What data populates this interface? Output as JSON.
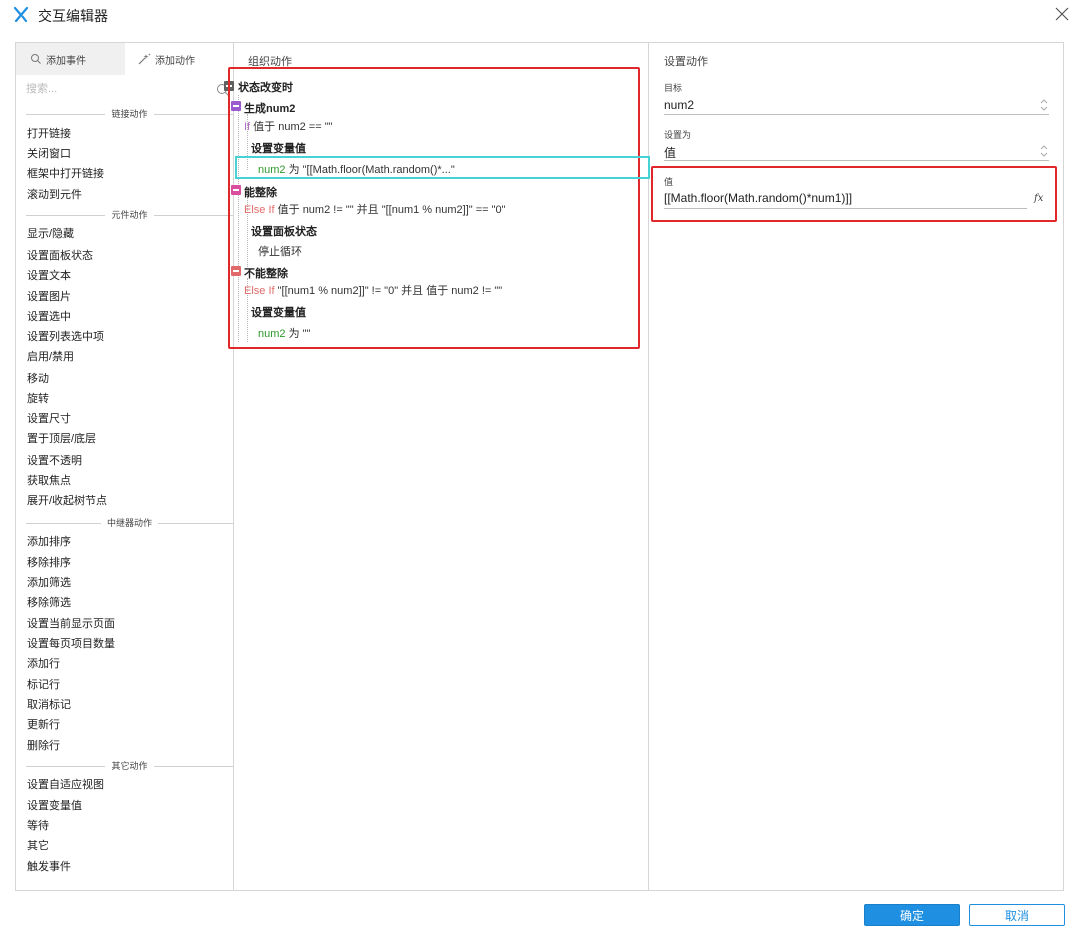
{
  "window": {
    "title": "交互编辑器",
    "accent": "#1e8fe1"
  },
  "left": {
    "tabs": [
      "添加事件",
      "添加动作"
    ],
    "search_placeholder": "搜索...",
    "groups": [
      {
        "header": "链接动作",
        "items": [
          "打开链接",
          "关闭窗口",
          "框架中打开链接",
          "滚动到元件"
        ]
      },
      {
        "header": "元件动作",
        "items": [
          "显示/隐藏",
          "设置面板状态",
          "设置文本",
          "设置图片",
          "设置选中",
          "设置列表选中项",
          "启用/禁用",
          "移动",
          "旋转",
          "设置尺寸",
          "置于顶层/底层",
          "设置不透明",
          "获取焦点",
          "展开/收起树节点"
        ]
      },
      {
        "header": "中继器动作",
        "items": [
          "添加排序",
          "移除排序",
          "添加筛选",
          "移除筛选",
          "设置当前显示页面",
          "设置每页项目数量",
          "添加行",
          "标记行",
          "取消标记",
          "更新行",
          "删除行"
        ]
      },
      {
        "header": "其它动作",
        "items": [
          "设置自适应视图",
          "设置变量值",
          "等待",
          "其它",
          "触发事件"
        ]
      }
    ]
  },
  "middle": {
    "title": "组织动作",
    "event": "状态改变时",
    "case1": {
      "name": "生成num2",
      "cond_kw": "If",
      "cond": " 值于 num2 == \"\"",
      "action": "设置变量值",
      "detail_var": "num2",
      "detail_rest": " 为 \"[[Math.floor(Math.random()*...\"",
      "color": "#9b59d0"
    },
    "case2": {
      "name": "能整除",
      "cond_kw": "Else If",
      "cond": " 值于 num2 != \"\" 并且 \"[[num1 % num2]]\" == \"0\"",
      "action": "设置面板状态",
      "detail": "停止循环",
      "color": "#d94f9e"
    },
    "case3": {
      "name": "不能整除",
      "cond_kw": "Else If",
      "cond": " \"[[num1 % num2]]\" != \"0\" 并且 值于 num2 != \"\"",
      "action": "设置变量值",
      "detail_var": "num2",
      "detail_rest": " 为 \"\"",
      "color": "#e06a6a"
    }
  },
  "right": {
    "title": "设置动作",
    "target_label": "目标",
    "target_value": "num2",
    "set_label": "设置为",
    "set_value": "值",
    "value_label": "值",
    "value_text": "[[Math.floor(Math.random()*num1)]]",
    "fx_symbol": "fx"
  },
  "buttons": {
    "ok": "确定",
    "cancel": "取消"
  }
}
